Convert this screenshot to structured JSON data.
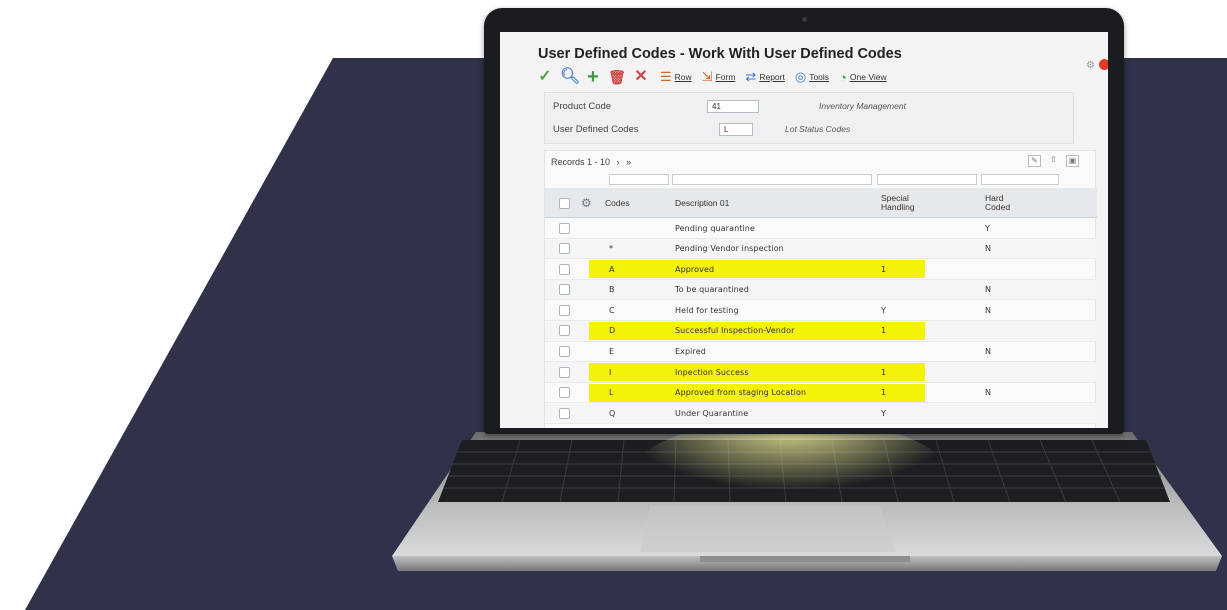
{
  "colors": {
    "page_background": "#ffffff",
    "dark_shape": "#2f3248",
    "highlight": "#f5f20a",
    "title_text": "#222222"
  },
  "window": {
    "title": "User Defined Codes - Work With User Defined Codes"
  },
  "toolbar": {
    "icons": [
      "check-icon",
      "search-icon",
      "add-icon",
      "delete-icon",
      "close-icon"
    ],
    "menus": [
      {
        "icon": "row-menu-icon",
        "label": "Row"
      },
      {
        "icon": "form-menu-icon",
        "label": "Form"
      },
      {
        "icon": "report-menu-icon",
        "label": "Report"
      },
      {
        "icon": "tools-menu-icon",
        "label": "Tools"
      },
      {
        "icon": "one-view-icon",
        "label": "One View"
      }
    ]
  },
  "search": {
    "product_code_label": "Product Code",
    "product_code_value": "41",
    "product_code_desc": "Inventory Management",
    "udc_label": "User Defined Codes",
    "udc_value": "L",
    "udc_desc": "Lot Status Codes"
  },
  "grid": {
    "records_label": "Records 1 - 10",
    "next_icon": "›",
    "last_icon": "»",
    "columns": {
      "codes": "Codes",
      "description": "Description 01",
      "special_handling_1": "Special",
      "special_handling_2": "Handling",
      "hard_coded_1": "Hard",
      "hard_coded_2": "Coded"
    },
    "rows": [
      {
        "code": "",
        "description": "Pending quarantine",
        "special": "",
        "hard": "Y",
        "highlighted": false
      },
      {
        "code": "*",
        "description": "Pending Vendor inspection",
        "special": "",
        "hard": "N",
        "highlighted": false
      },
      {
        "code": "A",
        "description": "Approved",
        "special": "1",
        "hard": "",
        "highlighted": true
      },
      {
        "code": "B",
        "description": "To be quarantined",
        "special": "",
        "hard": "N",
        "highlighted": false
      },
      {
        "code": "C",
        "description": "Held for testing",
        "special": "Y",
        "hard": "N",
        "highlighted": false
      },
      {
        "code": "D",
        "description": "Successful Inspection-Vendor",
        "special": "1",
        "hard": "",
        "highlighted": true
      },
      {
        "code": "E",
        "description": "Expired",
        "special": "",
        "hard": "N",
        "highlighted": false
      },
      {
        "code": "I",
        "description": "Inpection Success",
        "special": "1",
        "hard": "",
        "highlighted": true
      },
      {
        "code": "L",
        "description": "Approved from staging Location",
        "special": "1",
        "hard": "N",
        "highlighted": true
      },
      {
        "code": "Q",
        "description": "Under Quarantine",
        "special": "Y",
        "hard": "",
        "highlighted": false
      }
    ]
  }
}
